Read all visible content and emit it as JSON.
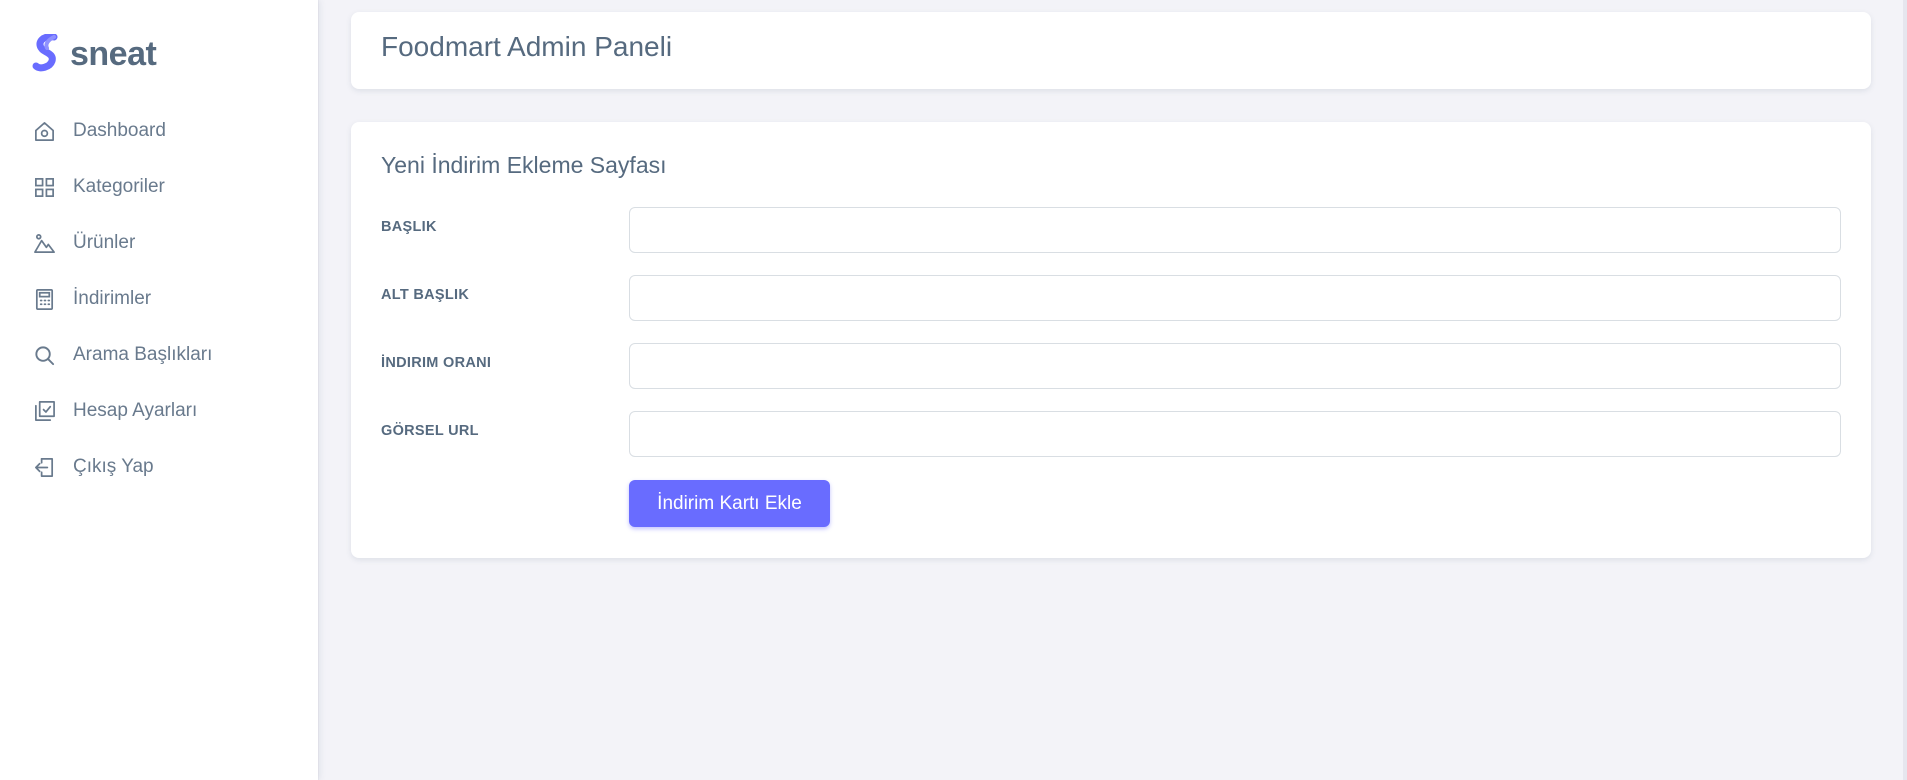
{
  "brand": {
    "name": "sneat"
  },
  "sidebar": {
    "items": [
      {
        "label": "Dashboard",
        "icon": "home-icon"
      },
      {
        "label": "Kategoriler",
        "icon": "grid-icon"
      },
      {
        "label": "Ürünler",
        "icon": "image-icon"
      },
      {
        "label": "İndirimler",
        "icon": "calculator-icon"
      },
      {
        "label": "Arama Başlıkları",
        "icon": "search-icon"
      },
      {
        "label": "Hesap Ayarları",
        "icon": "check-square-icon"
      },
      {
        "label": "Çıkış Yap",
        "icon": "logout-icon"
      }
    ]
  },
  "header": {
    "title": "Foodmart Admin Paneli"
  },
  "form": {
    "title": "Yeni İndirim Ekleme Sayfası",
    "fields": [
      {
        "label": "BAŞLIK",
        "value": ""
      },
      {
        "label": "ALT BAŞLIK",
        "value": ""
      },
      {
        "label": "İNDIRIM ORANI",
        "value": ""
      },
      {
        "label": "GÖRSEL URL",
        "value": ""
      }
    ],
    "submit_label": "İndirim Kartı Ekle"
  },
  "colors": {
    "accent": "#696cff",
    "text": "#566a7f",
    "background": "#f3f3f8"
  }
}
